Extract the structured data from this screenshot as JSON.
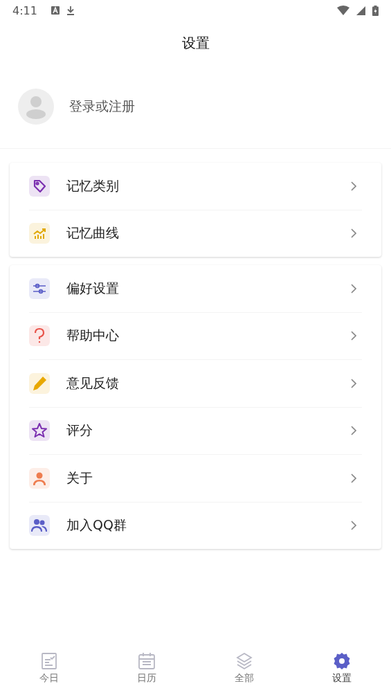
{
  "status_bar": {
    "time": "4:11"
  },
  "header": {
    "title": "设置"
  },
  "profile": {
    "label": "登录或注册"
  },
  "groups": [
    {
      "items": [
        {
          "label": "记忆类别",
          "kind": "tag",
          "color": "#7b2fb0"
        },
        {
          "label": "记忆曲线",
          "kind": "chart",
          "color": "#e0a800"
        }
      ]
    },
    {
      "items": [
        {
          "label": "偏好设置",
          "kind": "sliders",
          "color": "#5b5fc7"
        },
        {
          "label": "帮助中心",
          "kind": "question",
          "color": "#e8534a"
        },
        {
          "label": "意见反馈",
          "kind": "pencil",
          "color": "#e8a800"
        },
        {
          "label": "评分",
          "kind": "star",
          "color": "#7b2fb0"
        },
        {
          "label": "关于",
          "kind": "person",
          "color": "#ee7d4f"
        },
        {
          "label": "加入QQ群",
          "kind": "people",
          "color": "#5b5fc7"
        }
      ]
    }
  ],
  "nav": [
    {
      "label": "今日",
      "kind": "today",
      "selected": false
    },
    {
      "label": "日历",
      "kind": "calendar",
      "selected": false
    },
    {
      "label": "全部",
      "kind": "layers",
      "selected": false
    },
    {
      "label": "设置",
      "kind": "gear",
      "selected": true
    }
  ]
}
